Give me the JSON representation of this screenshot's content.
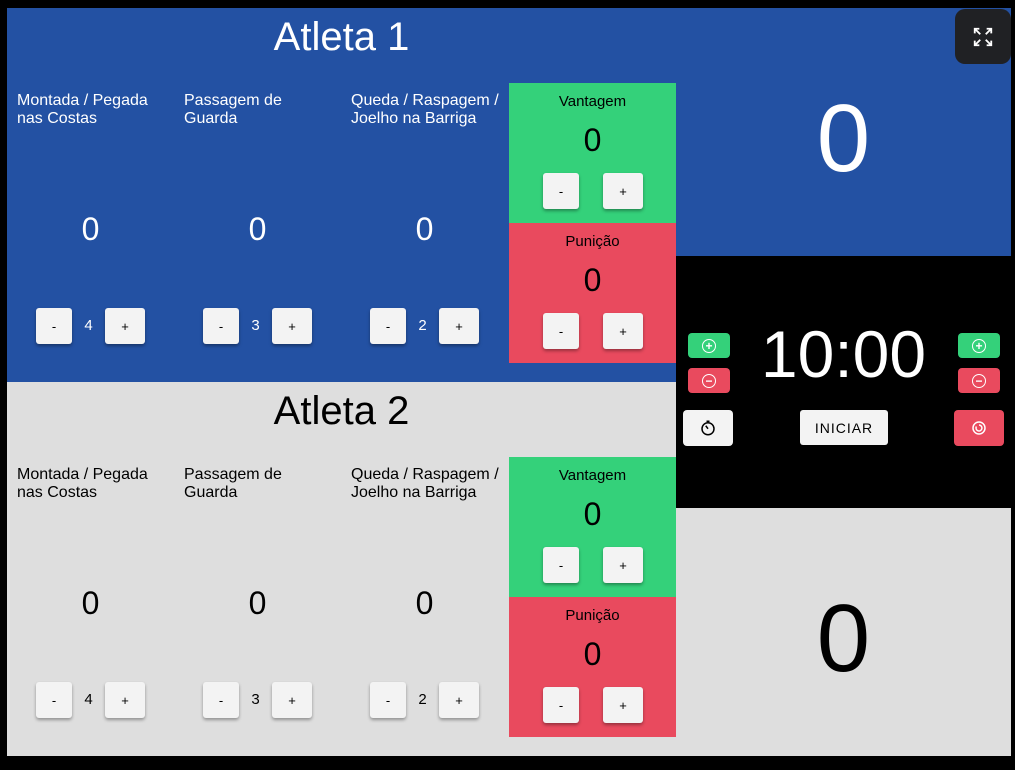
{
  "athletes": [
    {
      "name": "Atleta 1",
      "total": "0",
      "categories": [
        {
          "label": "Montada / Pegada nas Costas",
          "value": "0",
          "points": "4"
        },
        {
          "label": "Passagem de Guarda",
          "value": "0",
          "points": "3"
        },
        {
          "label": "Queda / Raspagem / Joelho na Barriga",
          "value": "0",
          "points": "2"
        }
      ],
      "vantagem": {
        "label": "Vantagem",
        "value": "0"
      },
      "punicao": {
        "label": "Punição",
        "value": "0"
      }
    },
    {
      "name": "Atleta 2",
      "total": "0",
      "categories": [
        {
          "label": "Montada / Pegada nas Costas",
          "value": "0",
          "points": "4"
        },
        {
          "label": "Passagem de Guarda",
          "value": "0",
          "points": "3"
        },
        {
          "label": "Queda / Raspagem / Joelho na Barriga",
          "value": "0",
          "points": "2"
        }
      ],
      "vantagem": {
        "label": "Vantagem",
        "value": "0"
      },
      "punicao": {
        "label": "Punição",
        "value": "0"
      }
    }
  ],
  "buttons": {
    "minus": "-",
    "plus": "+"
  },
  "timer": {
    "display": "10:00",
    "start_label": "INICIAR"
  },
  "icons": {
    "add_time": "plus-circle-icon",
    "remove_time": "minus-circle-icon",
    "stopwatch": "stopwatch-icon",
    "reset": "reset-icon",
    "fullscreen": "fullscreen-icon"
  },
  "colors": {
    "athlete1_bg": "#2351a3",
    "athlete2_bg": "#dedede",
    "vantagem": "#34d17a",
    "punicao": "#e94a5e",
    "timer_bg": "#000000"
  }
}
